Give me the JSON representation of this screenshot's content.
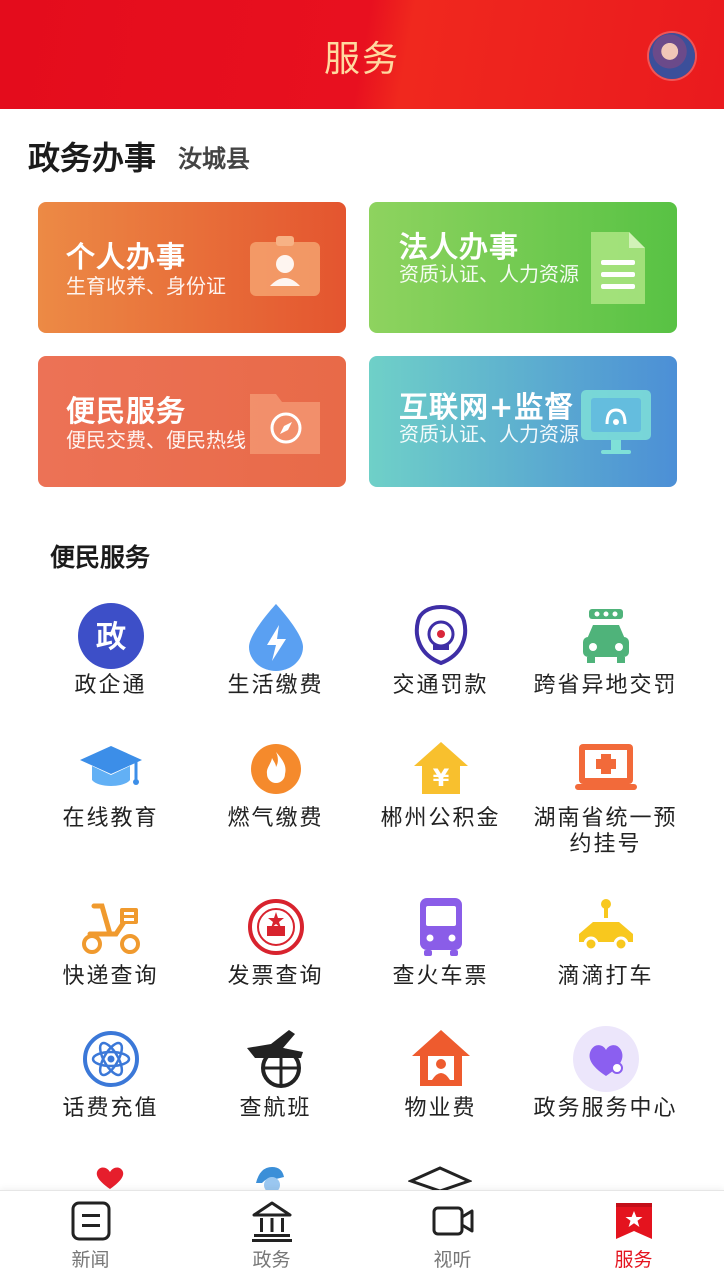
{
  "header": {
    "title": "服务"
  },
  "section": {
    "title": "政务办事",
    "county": "汝城县"
  },
  "cards": [
    {
      "title": "个人办事",
      "subtitle": "生育收养、身份证"
    },
    {
      "title": "法人办事",
      "subtitle": "资质认证、人力资源"
    },
    {
      "title": "便民服务",
      "subtitle": "便民交费、便民热线"
    },
    {
      "title": "互联网+监督",
      "subtitle": "资质认证、人力资源"
    }
  ],
  "services": {
    "title": "便民服务",
    "items": [
      {
        "label": "政企通",
        "icon": "zheng-badge-icon"
      },
      {
        "label": "生活缴费",
        "icon": "lightning-drop-icon"
      },
      {
        "label": "交通罚款",
        "icon": "police-emblem-icon"
      },
      {
        "label": "跨省异地交罚",
        "icon": "car-icon"
      },
      {
        "label": "在线教育",
        "icon": "graduation-cap-icon"
      },
      {
        "label": "燃气缴费",
        "icon": "flame-icon"
      },
      {
        "label": "郴州公积金",
        "icon": "yuan-house-icon"
      },
      {
        "label": "湖南省统一预约挂号",
        "icon": "medical-monitor-icon"
      },
      {
        "label": "快递查询",
        "icon": "scooter-icon"
      },
      {
        "label": "发票查询",
        "icon": "national-emblem-icon"
      },
      {
        "label": "查火车票",
        "icon": "bus-icon"
      },
      {
        "label": "滴滴打车",
        "icon": "taxi-icon"
      },
      {
        "label": "话费充值",
        "icon": "atom-icon"
      },
      {
        "label": "查航班",
        "icon": "airplane-globe-icon"
      },
      {
        "label": "物业费",
        "icon": "house-person-icon"
      },
      {
        "label": "政务服务中心",
        "icon": "heart-bubble-icon"
      }
    ]
  },
  "tabs": [
    {
      "label": "新闻",
      "icon": "news-icon"
    },
    {
      "label": "政务",
      "icon": "government-building-icon"
    },
    {
      "label": "视听",
      "icon": "video-camera-icon"
    },
    {
      "label": "服务",
      "icon": "star-bookmark-icon",
      "active": true
    }
  ],
  "colors": {
    "primary": "#e4131e",
    "header_title": "#ffd9a0"
  }
}
